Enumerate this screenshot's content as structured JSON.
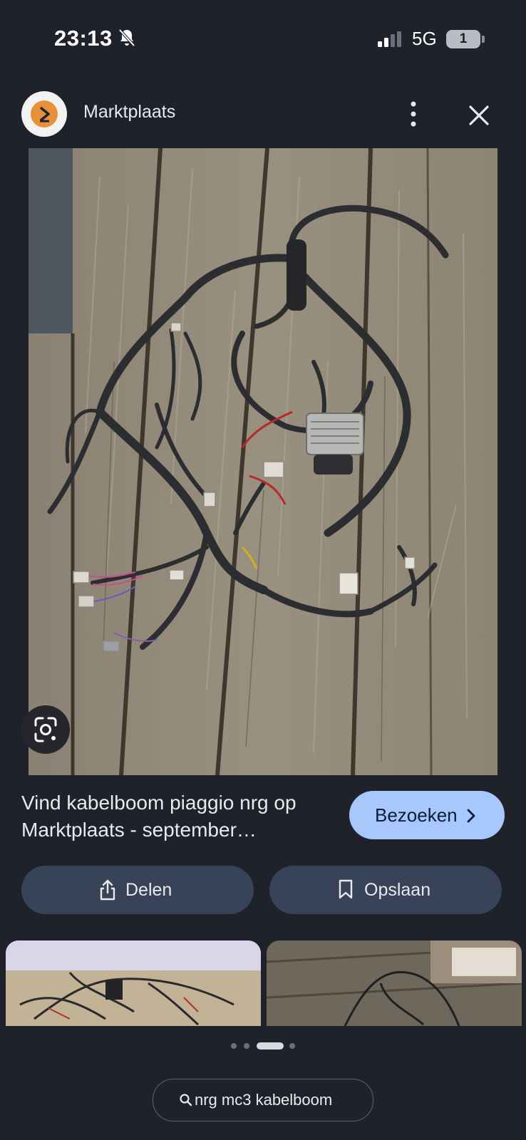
{
  "status_bar": {
    "time": "23:13",
    "network": "5G",
    "battery": "1",
    "icons": [
      "bell-off-icon",
      "signal-icon",
      "battery-icon"
    ]
  },
  "header": {
    "site_name": "Marktplaats",
    "icons": [
      "marktplaats-logo",
      "more-vert-icon",
      "close-icon"
    ]
  },
  "result": {
    "title": "Vind kabelboom piaggio nrg op Marktplaats - september…",
    "visit_label": "Bezoeken",
    "share_label": "Delen",
    "save_label": "Opslaan"
  },
  "carousel": {
    "dot_count": 4,
    "active_index": 2
  },
  "search_chip": {
    "label": "nrg mc3 kabelboom"
  },
  "colors": {
    "background": "#20222b",
    "accent_button": "#a8c7fa",
    "pill_button": "#394357",
    "logo_orange": "#e8913a"
  }
}
